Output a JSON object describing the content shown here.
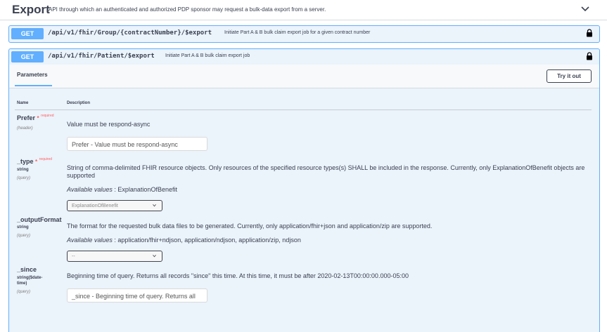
{
  "tag": {
    "title": "Export",
    "description": "API through which an authenticated and authorized PDP sponsor may request a bulk-data export from a server."
  },
  "operations": [
    {
      "method": "GET",
      "path": "/api/v1/fhir/Group/{contractNumber}/$export",
      "summary": "Initiate Part A & B bulk claim export job for a given contract number"
    },
    {
      "method": "GET",
      "path": "/api/v1/fhir/Patient/$export",
      "summary": "Initiate Part A & B bulk claim export job"
    }
  ],
  "section": {
    "tab_label": "Parameters",
    "try_button": "Try it out",
    "col_name": "Name",
    "col_description": "Description"
  },
  "params": [
    {
      "name": "Prefer",
      "required_star": "*",
      "required_label": "required",
      "type": "",
      "in": "(header)",
      "description": "Value must be respond-async",
      "input_placeholder": "Prefer - Value must be respond-async"
    },
    {
      "name": "_type",
      "required_star": "*",
      "required_label": "required",
      "type": "string",
      "in": "(query)",
      "description": "String of comma-delimited FHIR resource objects. Only resources of the specified resource types(s) SHALL be included in the response. Currently, only ExplanationOfBenefit objects are supported",
      "available_label": "Available values",
      "available_values": ": ExplanationOfBenefit",
      "select_value": "ExplanationOfBenefit"
    },
    {
      "name": "_outputFormat",
      "type": "string",
      "in": "(query)",
      "description": "The format for the requested bulk data files to be generated. Currently, only application/fhir+json and application/zip are supported.",
      "available_label": "Available values",
      "available_values": ": application/fhir+ndjson, application/ndjson, application/zip, ndjson",
      "select_value": "--"
    },
    {
      "name": "_since",
      "type_line1": "string($date-",
      "type_line2": "time)",
      "in": "(query)",
      "description": "Beginning time of query. Returns all records \"since\" this time. At this time, it must be after 2020-02-13T00:00:00.000-05:00",
      "input_placeholder": "_since - Beginning time of query. Returns all"
    }
  ],
  "colors": {
    "get_blue": "#61affe",
    "op_bg": "#ebf3fb",
    "required_red": "#ff6060",
    "text": "#3b4151"
  }
}
